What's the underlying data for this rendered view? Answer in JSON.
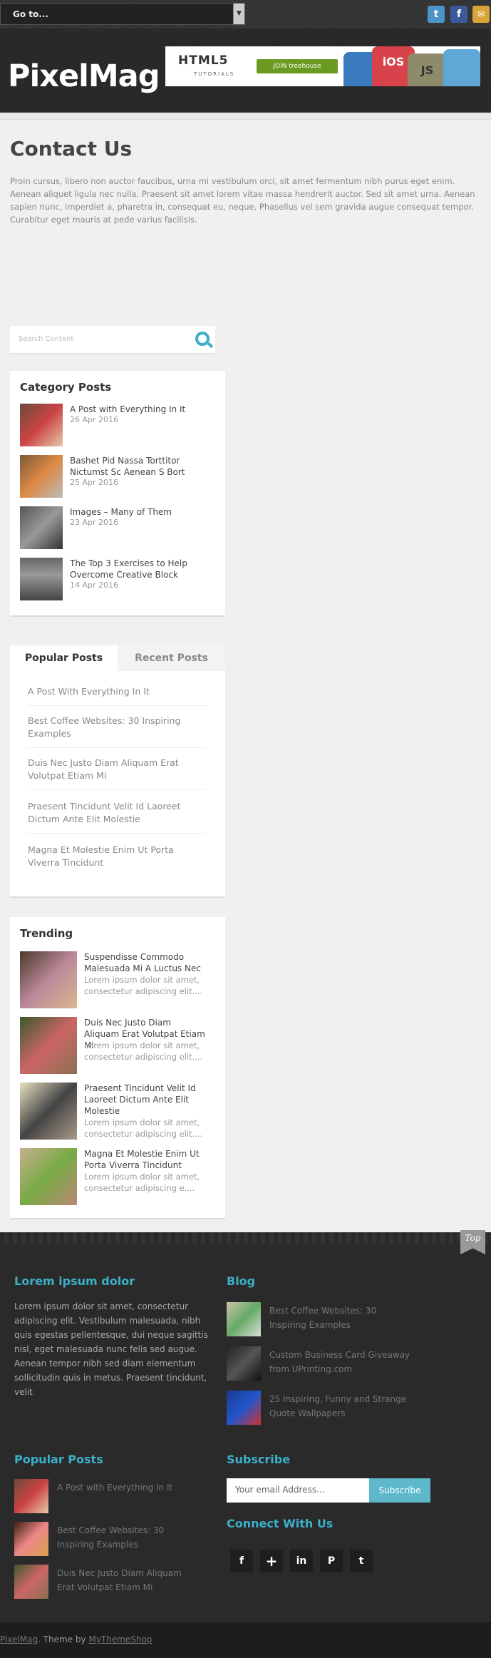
{
  "topbar": {
    "goto_label": "Go to...",
    "social": [
      {
        "name": "twitter-icon",
        "glyph": "t",
        "color": "#3f8fc6"
      },
      {
        "name": "facebook-icon",
        "glyph": "f",
        "color": "#3b5998"
      },
      {
        "name": "email-icon",
        "glyph": "✉",
        "color": "#d9a43a"
      }
    ]
  },
  "header": {
    "logo": "PixelMag",
    "banner": {
      "title": "HTML5",
      "subtitle": "TUTORIALS",
      "button": "JOIN treehouse",
      "tiles": [
        "iOS",
        "JS"
      ]
    }
  },
  "page": {
    "title": "Contact Us",
    "text": "Proin cursus, libero non auctor faucibus, urna mi vestibulum orci, sit amet fermentum nibh purus eget enim. Aenean aliquet ligula nec nulla. Praesent sit amet lorem vitae massa hendrerit auctor. Sed sit amet urna. Aenean sapien nunc, imperdiet a, pharetra in, consequat eu, neque. Phasellus vel sem gravida augue consequat tempor. Curabitur eget mauris at pede varius facilisis."
  },
  "search": {
    "placeholder": "Search Content"
  },
  "category_posts": {
    "title": "Category Posts",
    "items": [
      {
        "title": "A Post with Everything In It",
        "date": "26 Apr 2016"
      },
      {
        "title": "Bashet Pid Nassa Torttitor Nictumst Sc Aenean S Bort",
        "date": "25 Apr 2016"
      },
      {
        "title": "Images – Many of Them",
        "date": "23 Apr 2016"
      },
      {
        "title": "The Top 3 Exercises to Help Overcome Creative Block",
        "date": "14 Apr 2016"
      }
    ]
  },
  "tabs": {
    "popular": "Popular Posts",
    "recent": "Recent Posts"
  },
  "popular_list": [
    "A Post With Everything In It",
    "Best Coffee Websites: 30 Inspiring Examples",
    "Duis Nec Justo Diam Aliquam Erat Volutpat Etiam Mi",
    "Praesent Tincidunt Velit Id Laoreet Dictum Ante Elit Molestie",
    "Magna Et Molestie Enim Ut Porta Viverra Tincidunt"
  ],
  "trending": {
    "title": "Trending",
    "items": [
      {
        "title": "Suspendisse Commodo Malesuada Mi A Luctus Nec",
        "excerpt": "Lorem ipsum dolor sit amet, consectetur adipiscing elit...."
      },
      {
        "title": "Duis Nec Justo Diam Aliquam Erat Volutpat Etiam Mi",
        "excerpt": "Lorem ipsum dolor sit amet, consectetur adipiscing elit...."
      },
      {
        "title": "Praesent Tincidunt Velit Id Laoreet Dictum Ante Elit Molestie",
        "excerpt": "Lorem ipsum dolor sit amet, consectetur adipiscing elit...."
      },
      {
        "title": "Magna Et Molestie Enim Ut Porta Viverra Tincidunt",
        "excerpt": "Lorem ipsum dolor sit amet, consectetur adipiscing e...."
      }
    ]
  },
  "footer": {
    "top_label": "Top",
    "about": {
      "title": "Lorem ipsum dolor",
      "text": "Lorem ipsum dolor sit amet, consectetur adipiscing elit. Vestibulum malesuada, nibh quis egestas pellentesque, dui neque sagittis nisl, eget malesuada nunc felis sed augue. Aenean tempor nibh sed diam elementum sollicitudin quis in metus. Praesent tincidunt, velit"
    },
    "blog": {
      "title": "Blog",
      "items": [
        "Best Coffee Websites: 30 Inspiring Examples",
        "Custom Business Card Giveaway from UPrinting.com",
        "25 Inspiring, Funny and Strange Quote Wallpapers"
      ]
    },
    "popular": {
      "title": "Popular Posts",
      "items": [
        "A Post with Everything In It",
        "Best Coffee Websites: 30 Inspiring Examples",
        "Duis Nec Justo Diam Aliquam Erat Volutpat Etiam Mi"
      ]
    },
    "subscribe": {
      "title": "Subscribe",
      "placeholder": "Your email Address...",
      "button": "Subscribe"
    },
    "connect": {
      "title": "Connect With Us",
      "icons": [
        {
          "name": "facebook-icon",
          "glyph": "f"
        },
        {
          "name": "google-plus-icon",
          "glyph": "+"
        },
        {
          "name": "linkedin-icon",
          "glyph": "in"
        },
        {
          "name": "pinterest-icon",
          "glyph": "P"
        },
        {
          "name": "twitter-icon",
          "glyph": "t"
        }
      ]
    }
  },
  "bottom": {
    "site": "PixelMag",
    "theme_by": ". Theme by ",
    "author": "MyThemeShop"
  }
}
